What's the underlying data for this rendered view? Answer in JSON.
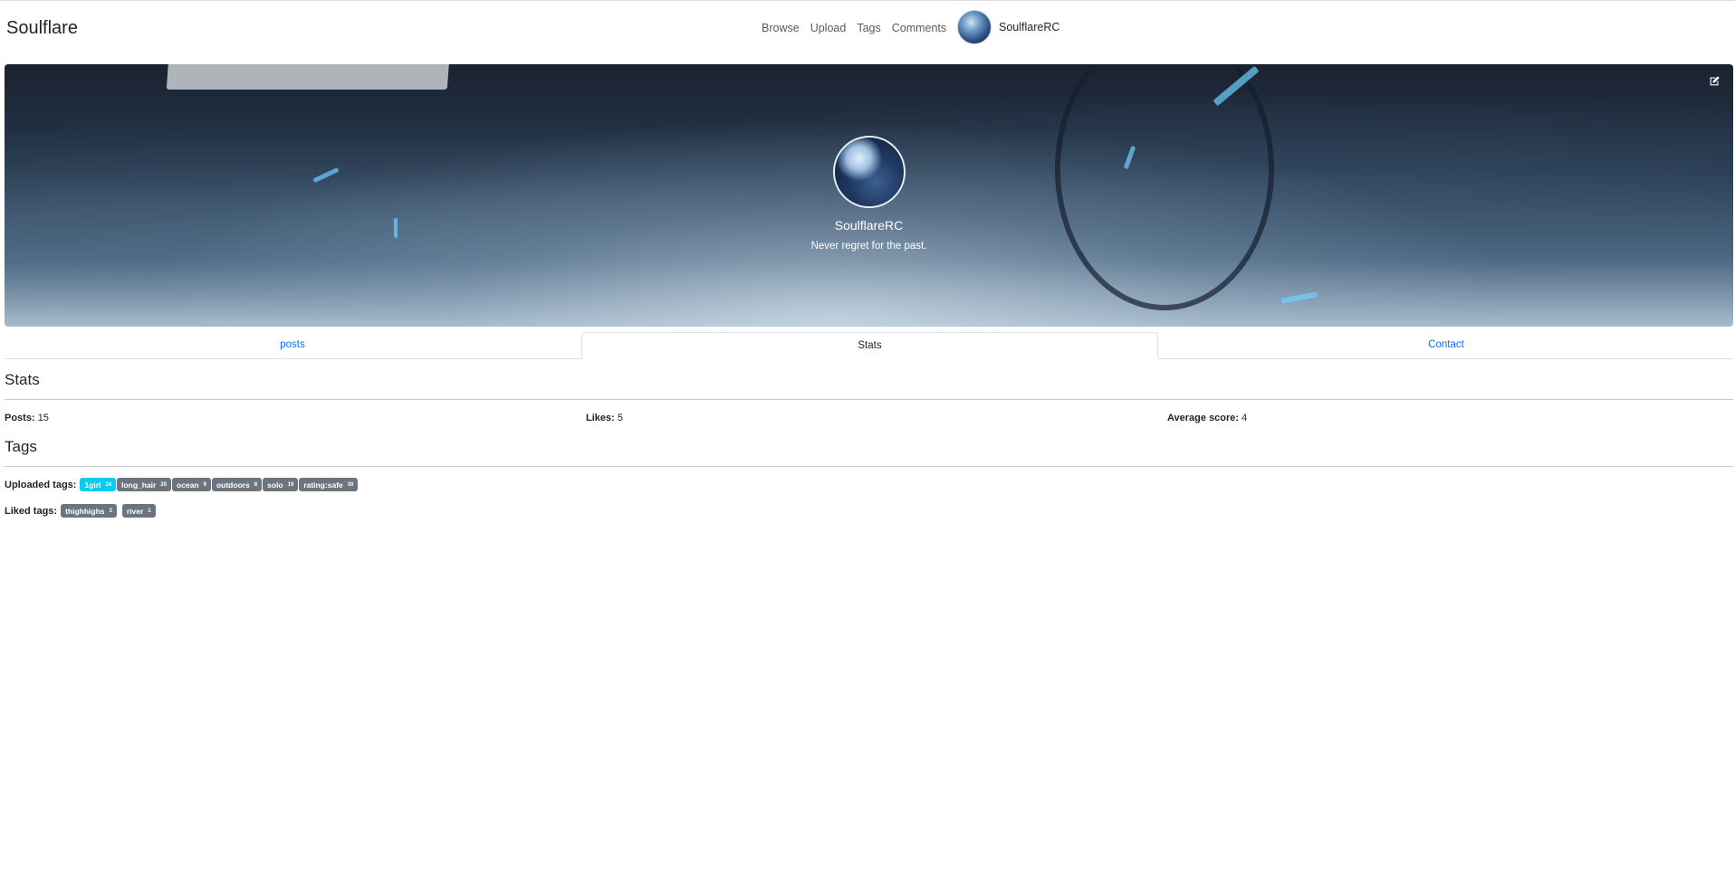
{
  "brand": "Soulflare",
  "nav": {
    "links": [
      "Browse",
      "Upload",
      "Tags",
      "Comments"
    ],
    "user": "SoulflareRC"
  },
  "profile": {
    "name": "SoulflareRC",
    "bio": "Never regret for the past.",
    "edit_icon": "edit-icon"
  },
  "tabs": {
    "posts": "posts",
    "stats": "Stats",
    "contact": "Contact",
    "active": "Stats"
  },
  "stats": {
    "title": "Stats",
    "posts_label": "Posts:",
    "posts_value": "15",
    "likes_label": "Likes:",
    "likes_value": "5",
    "avg_label": "Average score:",
    "avg_value": "4"
  },
  "tags": {
    "title": "Tags",
    "uploaded_label": "Uploaded tags:",
    "uploaded": [
      {
        "name": "1girl",
        "count": "24",
        "style": "info"
      },
      {
        "name": "long_hair",
        "count": "20",
        "style": "secondary"
      },
      {
        "name": "ocean",
        "count": "9",
        "style": "secondary"
      },
      {
        "name": "outdoors",
        "count": "8",
        "style": "secondary"
      },
      {
        "name": "solo",
        "count": "19",
        "style": "secondary"
      },
      {
        "name": "rating:safe",
        "count": "30",
        "style": "secondary"
      }
    ],
    "liked_label": "Liked tags:",
    "liked": [
      {
        "name": "thighhighs",
        "count": "3",
        "style": "secondary"
      },
      {
        "name": "river",
        "count": "1",
        "style": "secondary"
      }
    ]
  },
  "colors": {
    "link": "#0d6efd",
    "badge_secondary": "#6c757d",
    "badge_info": "#0dcaf0"
  }
}
